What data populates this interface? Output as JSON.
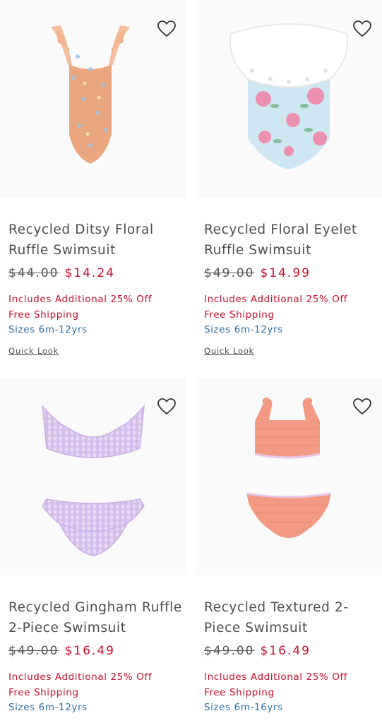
{
  "products": [
    {
      "title": "Recycled Ditsy Floral Ruffle Swimsuit",
      "original_price": "$44.00",
      "sale_price": "$14.24",
      "promo": "Includes Additional 25% Off",
      "shipping": "Free Shipping",
      "sizes": "Sizes 6m-12yrs",
      "quick_look": "Quick Look"
    },
    {
      "title": "Recycled Floral Eyelet Ruffle Swimsuit",
      "original_price": "$49.00",
      "sale_price": "$14.99",
      "promo": "Includes Additional 25% Off",
      "shipping": "Free Shipping",
      "sizes": "Sizes 6m-12yrs",
      "quick_look": "Quick Look"
    },
    {
      "title": "Recycled Gingham Ruffle 2-Piece Swimsuit",
      "original_price": "$49.00",
      "sale_price": "$16.49",
      "promo": "Includes Additional 25% Off",
      "shipping": "Free Shipping",
      "sizes": "Sizes 6m-12yrs"
    },
    {
      "title": "Recycled Textured 2-Piece Swimsuit",
      "original_price": "$49.00",
      "sale_price": "$16.49",
      "promo": "Includes Additional 25% Off",
      "shipping": "Free Shipping",
      "sizes": "Sizes 6m-16yrs"
    }
  ],
  "icons": {
    "favorite": "heart-outline-icon"
  },
  "colors": {
    "sale": "#c8102e",
    "sizes": "#2f6fa3",
    "text": "#4d4d4d"
  }
}
